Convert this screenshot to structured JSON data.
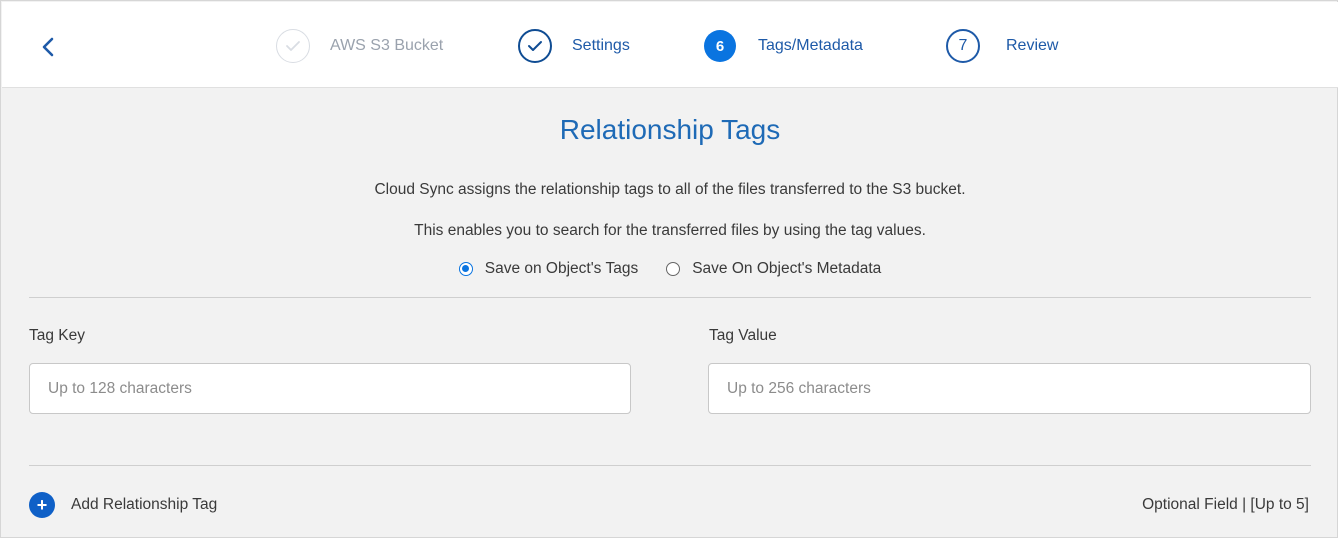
{
  "stepper": {
    "steps": [
      {
        "number": "",
        "label": "AWS S3 Bucket",
        "state": "completed-faded"
      },
      {
        "number": "",
        "label": "Settings",
        "state": "completed"
      },
      {
        "number": "6",
        "label": "Tags/Metadata",
        "state": "active"
      },
      {
        "number": "7",
        "label": "Review",
        "state": "upcoming"
      }
    ]
  },
  "main": {
    "title": "Relationship Tags",
    "description_1": "Cloud Sync assigns the relationship tags to all of the files transferred to the S3 bucket.",
    "description_2": "This enables you to search for the transferred files by using the tag values.",
    "radio_options": [
      {
        "label": "Save on Object's Tags",
        "selected": true
      },
      {
        "label": "Save On Object's Metadata",
        "selected": false
      }
    ],
    "tag_key": {
      "label": "Tag Key",
      "placeholder": "Up to 128 characters",
      "value": ""
    },
    "tag_value": {
      "label": "Tag Value",
      "placeholder": "Up to 256 characters",
      "value": ""
    },
    "add_tag_label": "Add Relationship Tag",
    "optional_note": "Optional Field | [Up to 5]"
  },
  "colors": {
    "accent": "#0a74e0",
    "title": "#1e6ab6",
    "background": "#f2f2f2"
  },
  "icons": {
    "back": "chevron-left-icon",
    "completed": "check-circle-icon",
    "add": "plus-circle-icon"
  }
}
